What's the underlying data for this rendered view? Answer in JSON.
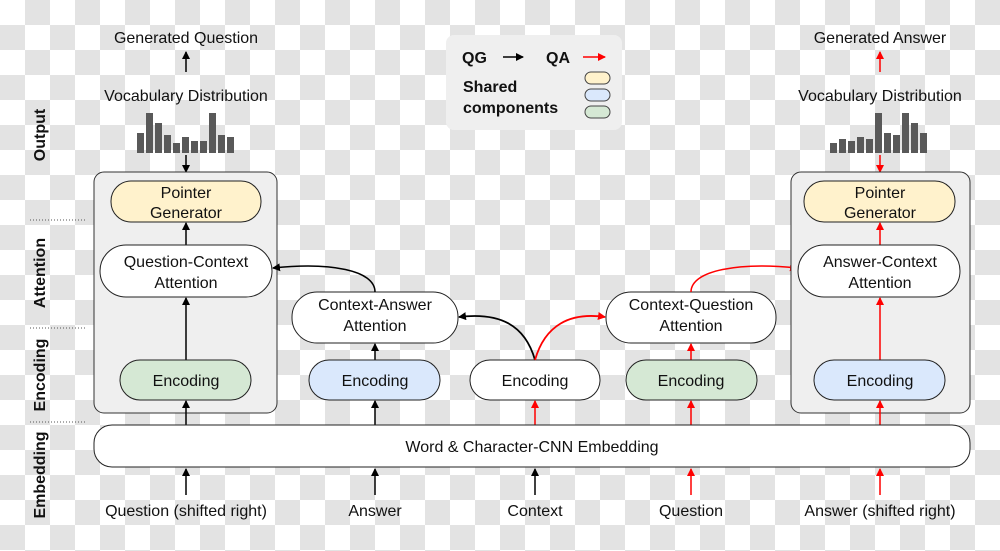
{
  "side_labels": {
    "output": "Output",
    "attention": "Attention",
    "encoding": "Encoding",
    "embedding": "Embedding"
  },
  "qg": {
    "output": "Generated Question",
    "vocab": "Vocabulary Distribution",
    "pointer": [
      "Pointer",
      "Generator"
    ],
    "attention": [
      "Question-Context",
      "Attention"
    ],
    "encoding": "Encoding"
  },
  "qa": {
    "output": "Generated Answer",
    "vocab": "Vocabulary Distribution",
    "pointer": [
      "Pointer",
      "Generator"
    ],
    "attention": [
      "Answer-Context",
      "Attention"
    ],
    "encoding": "Encoding"
  },
  "middle": {
    "ca_attention": [
      "Context-Answer",
      "Attention"
    ],
    "ca_encoding": "Encoding",
    "context_encoding": "Encoding",
    "cq_attention": [
      "Context-Question",
      "Attention"
    ],
    "cq_encoding": "Encoding"
  },
  "embedding": "Word & Character-CNN Embedding",
  "inputs": [
    "Question (shifted right)",
    "Answer",
    "Context",
    "Question",
    "Answer (shifted right)"
  ],
  "legend": {
    "qg": "QG",
    "qa": "QA",
    "shared": [
      "Shared",
      "components"
    ]
  },
  "colors": {
    "qg_arrow": "#000000",
    "qa_arrow": "#ff0000",
    "yellow": "#fff2cc",
    "blue": "#dae8fc",
    "green": "#d5e8d4",
    "bars": "#595959"
  }
}
